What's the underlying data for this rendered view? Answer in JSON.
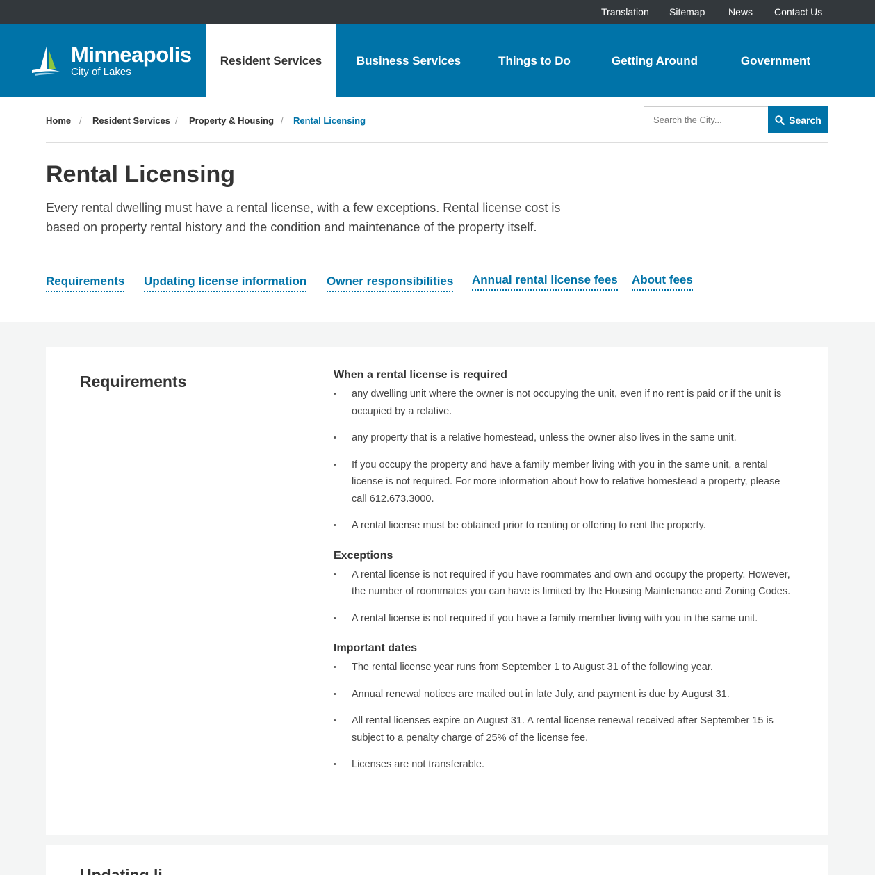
{
  "utility_nav": [
    "Translation",
    "Sitemap",
    "News",
    "Contact Us"
  ],
  "logo": {
    "title": "Minneapolis",
    "subtitle": "City of Lakes"
  },
  "main_nav": [
    {
      "label": "Resident Services",
      "active": true
    },
    {
      "label": "Business Services",
      "active": false
    },
    {
      "label": "Things to Do",
      "active": false
    },
    {
      "label": "Getting Around",
      "active": false
    },
    {
      "label": "Government",
      "active": false
    }
  ],
  "breadcrumb": [
    "Home",
    "Resident Services",
    "Property & Housing",
    "Rental Licensing"
  ],
  "search": {
    "placeholder": "Search the City...",
    "button_label": "Search"
  },
  "page": {
    "title": "Rental Licensing",
    "intro": "Every rental dwelling must have a rental license, with a few exceptions. Rental license cost is based on property rental history and the condition and maintenance of the property itself."
  },
  "jump_links": [
    "Requirements",
    "Updating license information",
    "Owner responsibilities",
    "Annual rental license fees",
    "About fees"
  ],
  "requirements": {
    "title": "Requirements",
    "sections": [
      {
        "heading": "When a rental license is required",
        "items": [
          "any dwelling unit where the owner is not occupying the unit, even if no rent is paid or if the unit is occupied by a relative.",
          "any property that is a relative homestead, unless the owner also lives in the same unit.",
          "If you occupy the property and have a family member living with you in the same unit, a rental license is not required. For more information about how to relative homestead a property, please call 612.673.3000.",
          "A rental license must be obtained prior to renting or offering to rent the property."
        ]
      },
      {
        "heading": "Exceptions",
        "items": [
          "A rental license is not required if you have roommates and own and occupy the property. However, the number of roommates you can have is limited by the Housing Maintenance and Zoning Codes.",
          "A rental license is not required if you have a family member living with you in the same unit."
        ]
      },
      {
        "heading": "Important dates",
        "items": [
          "The rental license year runs from September 1 to August 31 of the following year.",
          "Annual renewal notices are mailed out in late July, and payment is due by August 31.",
          "All rental licenses expire on August 31. A rental license renewal received after September 15 is subject to a penalty charge of 25% of the license fee.",
          "Licenses are not transferable."
        ]
      }
    ]
  },
  "next_section": {
    "title": "Updating li"
  },
  "colors": {
    "brand": "#0073a8",
    "utility_bar": "#33383c",
    "band": "#f4f5f5"
  }
}
